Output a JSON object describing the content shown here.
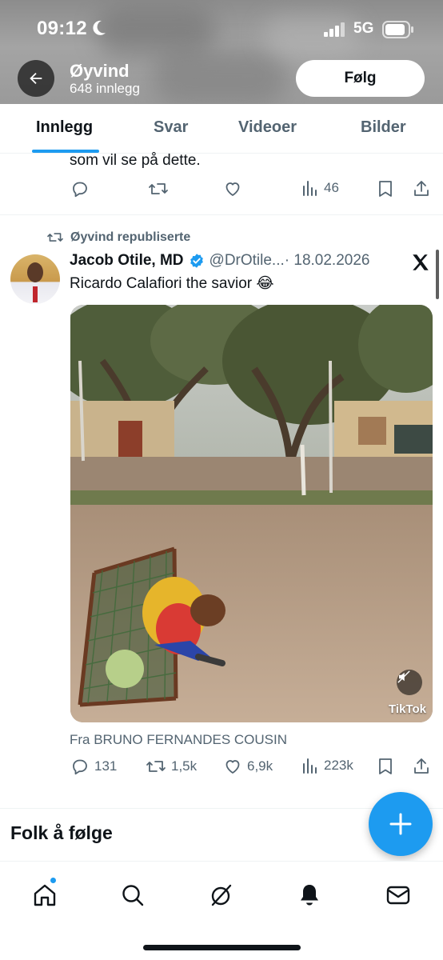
{
  "status_bar": {
    "time": "09:12",
    "network": "5G",
    "icons": [
      "moon-icon",
      "signal-icon",
      "battery-icon"
    ]
  },
  "profile_header": {
    "name": "Øyvind",
    "post_count": "648 innlegg",
    "follow_label": "Følg",
    "back_icon": "arrow-left-icon"
  },
  "tabs": [
    {
      "label": "Innlegg",
      "active": true
    },
    {
      "label": "Svar",
      "active": false
    },
    {
      "label": "Videoer",
      "active": false
    },
    {
      "label": "Bilder",
      "active": false
    }
  ],
  "previous_post": {
    "text_tail": "som vil se på dette.",
    "views": "46"
  },
  "repost": {
    "repost_label": "Øyvind republiserte",
    "author_name": "Jacob Otile, MD",
    "handle": "@DrOtile...",
    "date": "· 18.02.2026",
    "text": "Ricardo Calafiori the savior 😂",
    "media_watermark": "TikTok",
    "source": "Fra BRUNO FERNANDES COUSIN",
    "stats": {
      "replies": "131",
      "reposts": "1,5k",
      "likes": "6,9k",
      "views": "223k"
    }
  },
  "who_to_follow": {
    "title": "Folk å følge"
  },
  "colors": {
    "accent": "#1d9bf0",
    "text_primary": "#0f1419",
    "text_secondary": "#536471"
  },
  "bottom_nav": [
    "home-icon",
    "search-icon",
    "grok-icon",
    "notifications-icon",
    "messages-icon"
  ]
}
